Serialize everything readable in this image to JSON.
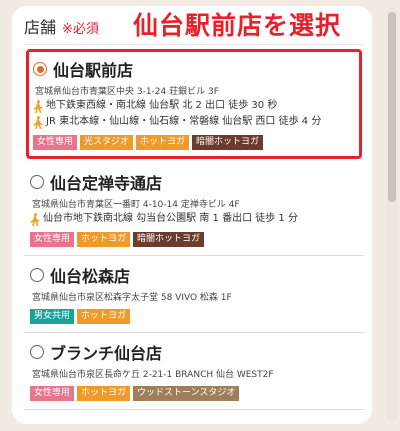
{
  "header": {
    "label": "店舗",
    "required": "※必須",
    "callout": "仙台駅前店を選択"
  },
  "stores": [
    {
      "name": "仙台駅前店",
      "selected": true,
      "address": "宮城県仙台市青葉区中央 3-1-24 荘銀ビル 3F",
      "access": [
        "地下鉄東西線・南北線 仙台駅 北 2 出口 徒歩 30 秒",
        "JR 東北本線・仙山線・仙石線・常磐線 仙台駅 西口 徒歩 4 分"
      ],
      "tags": [
        "女性専用",
        "光スタジオ",
        "ホットヨガ",
        "暗闇ホットヨガ"
      ]
    },
    {
      "name": "仙台定禅寺通店",
      "selected": false,
      "address": "宮城県仙台市青葉区一番町 4-10-14 定禅寺ビル 4F",
      "access": [
        "仙台市地下鉄南北線 勾当台公園駅 南 1 番出口 徒歩 1 分"
      ],
      "tags": [
        "女性専用",
        "ホットヨガ",
        "暗闇ホットヨガ"
      ]
    },
    {
      "name": "仙台松森店",
      "selected": false,
      "address": "宮城県仙台市泉区松森字太子堂 58 VIVO 松森 1F",
      "access": [],
      "tags": [
        "男女共用",
        "ホットヨガ"
      ]
    },
    {
      "name": "ブランチ仙台店",
      "selected": false,
      "address": "宮城県仙台市泉区長命ケ丘 2-21-1 BRANCH 仙台 WEST2F",
      "access": [],
      "tags": [
        "女性専用",
        "ホットヨガ",
        "ウッドストーンスタジオ"
      ]
    }
  ]
}
